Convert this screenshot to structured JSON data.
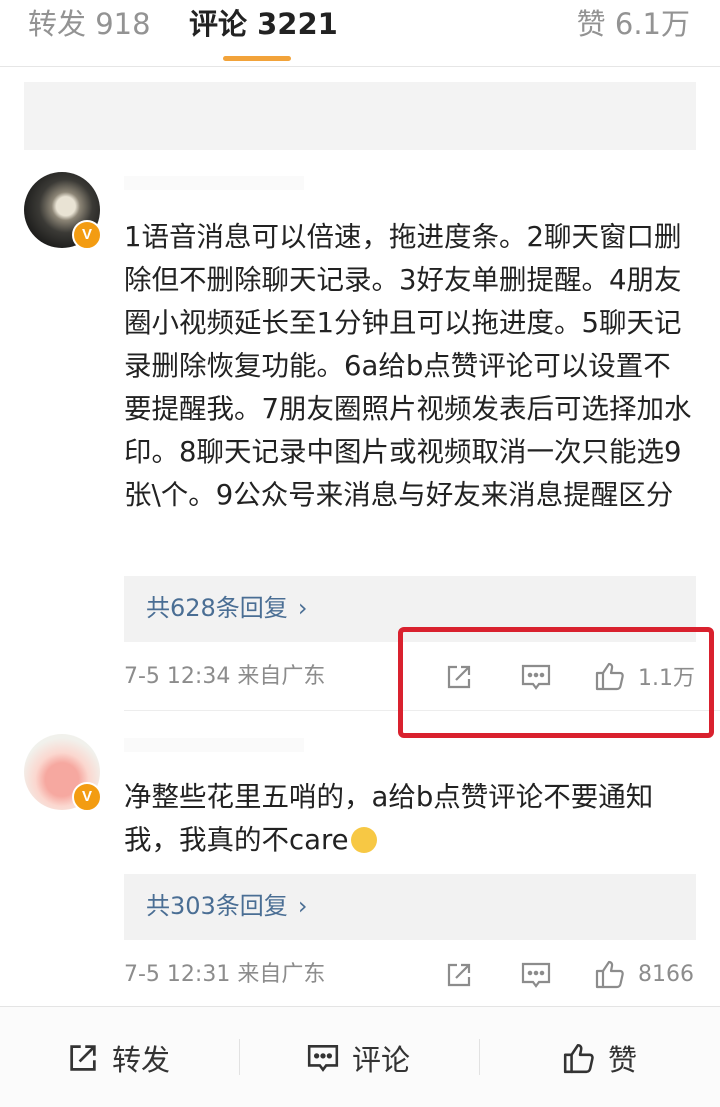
{
  "tabs": {
    "repost": "转发 918",
    "comment": "评论 3221",
    "like": "赞 6.1万"
  },
  "comments": [
    {
      "text": "1语音消息可以倍速，拖进度条。2聊天窗口删除但不删除聊天记录。3好友单删提醒。4朋友圈小视频延长至1分钟且可以拖进度。5聊天记录删除恢复功能。6a给b点赞评论可以设置不要提醒我。7朋友圈照片视频发表后可选择加水印。8聊天记录中图片或视频取消一次只能选9张\\个。9公众号来消息与好友来消息提醒区分",
      "replies": "共628条回复",
      "time": "7-5 12:34 来自广东",
      "likes": "1.1万"
    },
    {
      "text": "净整些花里五哨的，a给b点赞评论不要通知我，我真的不care",
      "replies": "共303条回复",
      "time": "7-5 12:31 来自广东",
      "likes": "8166"
    }
  ],
  "badge": "V",
  "reply_chevron": "›",
  "bottom_bar": {
    "repost": "转发",
    "comment": "评论",
    "like": "赞"
  },
  "colors": {
    "accent": "#f2a33a",
    "highlight": "#d9212e",
    "link": "#4a6e94"
  }
}
